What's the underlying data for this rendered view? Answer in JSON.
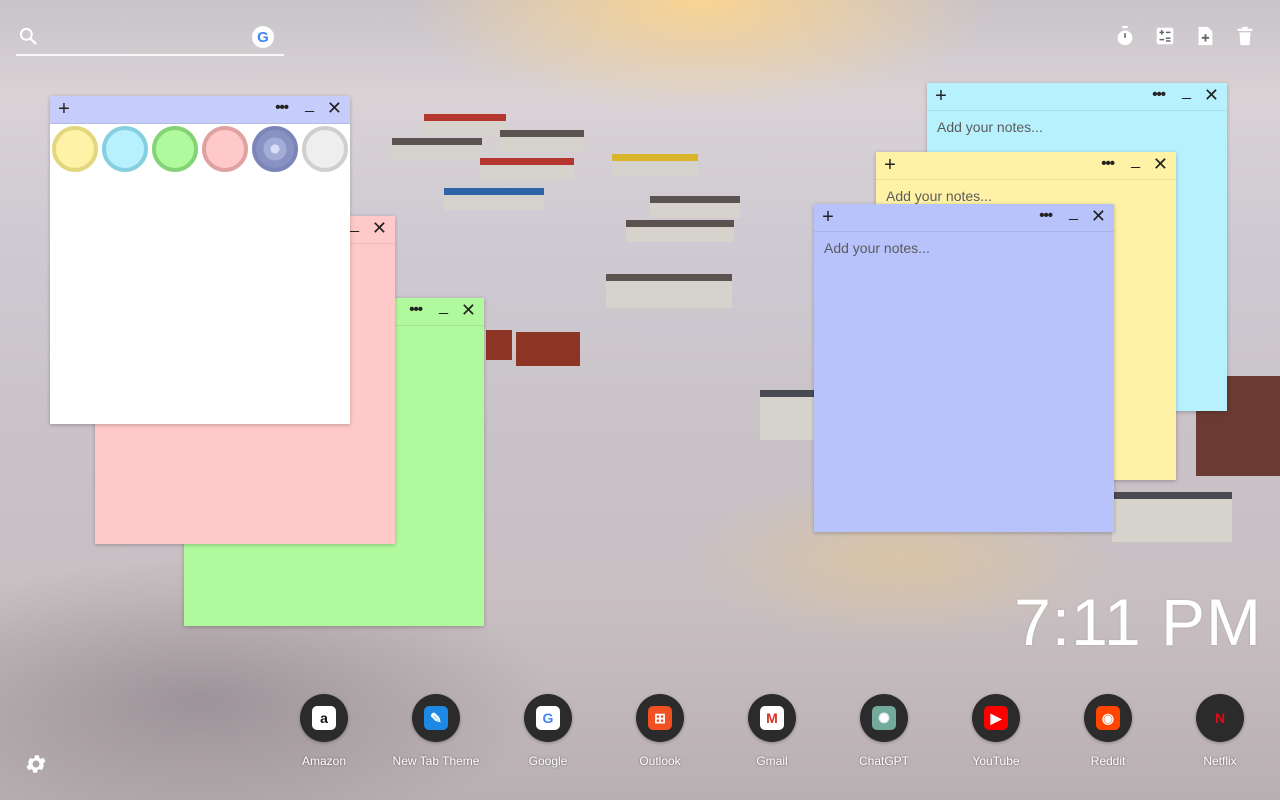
{
  "search": {
    "placeholder": ""
  },
  "top_actions": [
    {
      "name": "timer-icon"
    },
    {
      "name": "calculator-icon"
    },
    {
      "name": "new-note-icon"
    },
    {
      "name": "trash-icon"
    }
  ],
  "notes": {
    "placeholder": "Add your notes...",
    "colors": {
      "white": "#ffffff",
      "pink": "#ffc9c9",
      "green": "#b0fa9d",
      "cyan": "#b6f1fd",
      "yellow": "#fff2a6",
      "blue": "#b8c3fc"
    }
  },
  "palette": [
    {
      "name": "yellow",
      "fill": "#fff2a6",
      "ring": "#e2d77f"
    },
    {
      "name": "cyan",
      "fill": "#b6f1fd",
      "ring": "#86cfe0"
    },
    {
      "name": "green",
      "fill": "#b0fa9d",
      "ring": "#84d377"
    },
    {
      "name": "pink",
      "fill": "#ffc9c9",
      "ring": "#e0a1a1"
    },
    {
      "name": "blue",
      "fill": "#a4acd8",
      "ring": "#7c85b8"
    },
    {
      "name": "gray",
      "fill": "#eeeeee",
      "ring": "#cfcfcf"
    }
  ],
  "clock": {
    "time": "7:11 PM"
  },
  "dock": [
    {
      "label": "Amazon",
      "glyph": "a",
      "bg": "#ffffff",
      "fg": "#111111"
    },
    {
      "label": "New Tab Theme",
      "glyph": "✎",
      "bg": "#1e88e5",
      "fg": "#ffffff"
    },
    {
      "label": "Google",
      "glyph": "G",
      "bg": "#ffffff",
      "fg": "#4285f4"
    },
    {
      "label": "Outlook",
      "glyph": "⊞",
      "bg": "#f25022",
      "fg": "#ffffff"
    },
    {
      "label": "Gmail",
      "glyph": "M",
      "bg": "#ffffff",
      "fg": "#d93025"
    },
    {
      "label": "ChatGPT",
      "glyph": "✺",
      "bg": "#74aa9c",
      "fg": "#ffffff"
    },
    {
      "label": "YouTube",
      "glyph": "▶",
      "bg": "#ff0000",
      "fg": "#ffffff"
    },
    {
      "label": "Reddit",
      "glyph": "◉",
      "bg": "#ff4500",
      "fg": "#ffffff"
    },
    {
      "label": "Netflix",
      "glyph": "N",
      "bg": "#2b2b2b",
      "fg": "#e50914"
    }
  ]
}
